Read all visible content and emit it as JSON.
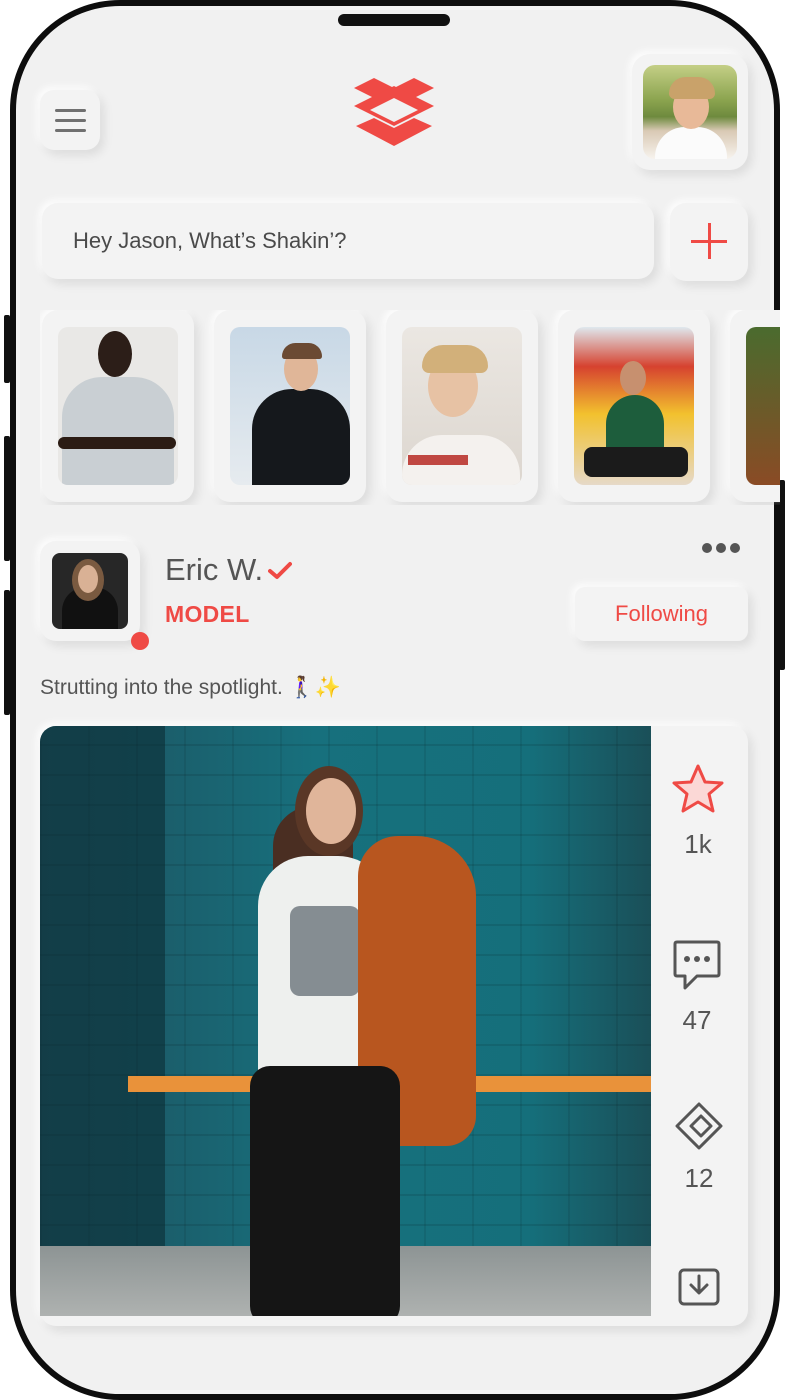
{
  "search": {
    "placeholder": "Hey Jason, What’s Shakin’?"
  },
  "header": {
    "menu_icon": "hamburger-icon",
    "logo_icon": "app-logo",
    "add_icon": "plus-icon"
  },
  "stories": [
    {
      "name": "story-1"
    },
    {
      "name": "story-2"
    },
    {
      "name": "story-3"
    },
    {
      "name": "story-4"
    },
    {
      "name": "story-5"
    }
  ],
  "post": {
    "author": "Eric W.",
    "role": "MODEL",
    "follow_label": "Following",
    "caption": "Strutting into the spotlight. 🚶‍♀️✨",
    "actions": {
      "likes": "1k",
      "comments": "47",
      "shares": "12"
    }
  },
  "colors": {
    "accent": "#ef4a45",
    "background": "#f1f1f1",
    "text": "#555555"
  }
}
